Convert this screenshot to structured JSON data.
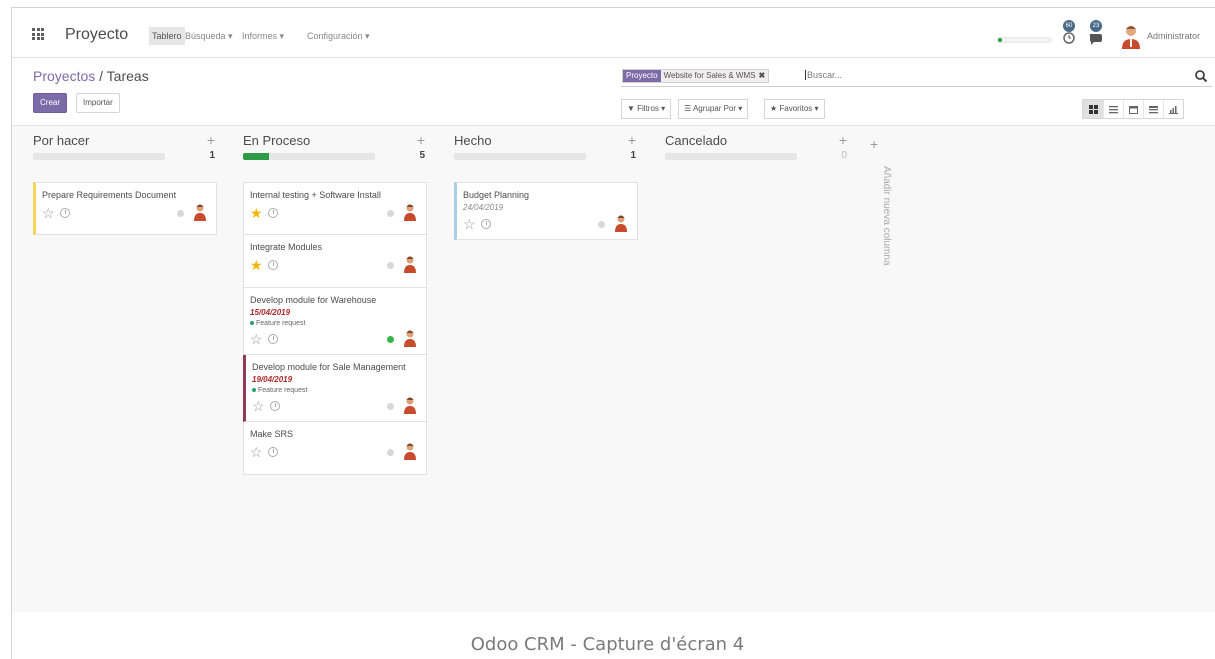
{
  "navbar": {
    "brand": "Proyecto",
    "menu": [
      {
        "label": "Tablero"
      },
      {
        "label": "Búsqueda ▾"
      },
      {
        "label": "Informes ▾"
      },
      {
        "label": "Configuración ▾"
      }
    ],
    "progress": 0.08,
    "activity_badge": "60",
    "messages_badge": "23",
    "user": "Administrator"
  },
  "control": {
    "breadcrumb_parent": "Proyectos",
    "breadcrumb_sep": " / ",
    "breadcrumb_current": "Tareas",
    "create_label": "Crear",
    "import_label": "Importar",
    "facet_title": "Proyecto",
    "facet_value": "Website for Sales & WMS",
    "facet_close": "✖",
    "search_placeholder": "Buscar...",
    "filters_label": "▼ Filtros ▾",
    "group_label": "☰ Agrupar Por ▾",
    "favorites_label": "★ Favoritos ▾",
    "accent_color": "#7c6ba7"
  },
  "kanban": {
    "columns": [
      {
        "title": "Por hacer",
        "count": "1",
        "progress": 0.0
      },
      {
        "title": "En Proceso",
        "count": "5",
        "progress": 0.2
      },
      {
        "title": "Hecho",
        "count": "1",
        "progress": 0.0
      },
      {
        "title": "Cancelado",
        "count": "0",
        "progress": 0.0
      }
    ],
    "cards": {
      "todo": [
        {
          "title": "Prepare Requirements Document",
          "starred": false,
          "status": "grey"
        }
      ],
      "progress": [
        {
          "title": "Internal testing + Software Install",
          "starred": true,
          "status": "grey"
        },
        {
          "title": "Integrate Modules",
          "starred": true,
          "status": "grey"
        },
        {
          "title": "Develop module for Warehouse",
          "date": "15/04/2019",
          "tag": "Feature request",
          "starred": false,
          "status": "green"
        },
        {
          "title": "Develop module for Sale Management",
          "date": "19/04/2019",
          "tag": "Feature request",
          "starred": false,
          "status": "grey"
        },
        {
          "title": "Make SRS",
          "starred": false,
          "status": "grey"
        }
      ],
      "done": [
        {
          "title": "Budget Planning",
          "date": "24/04/2019",
          "starred": false,
          "status": "grey"
        }
      ]
    },
    "add_column_label": "Añadir nueva columna"
  },
  "caption": "Odoo CRM - Capture d'écran 4"
}
